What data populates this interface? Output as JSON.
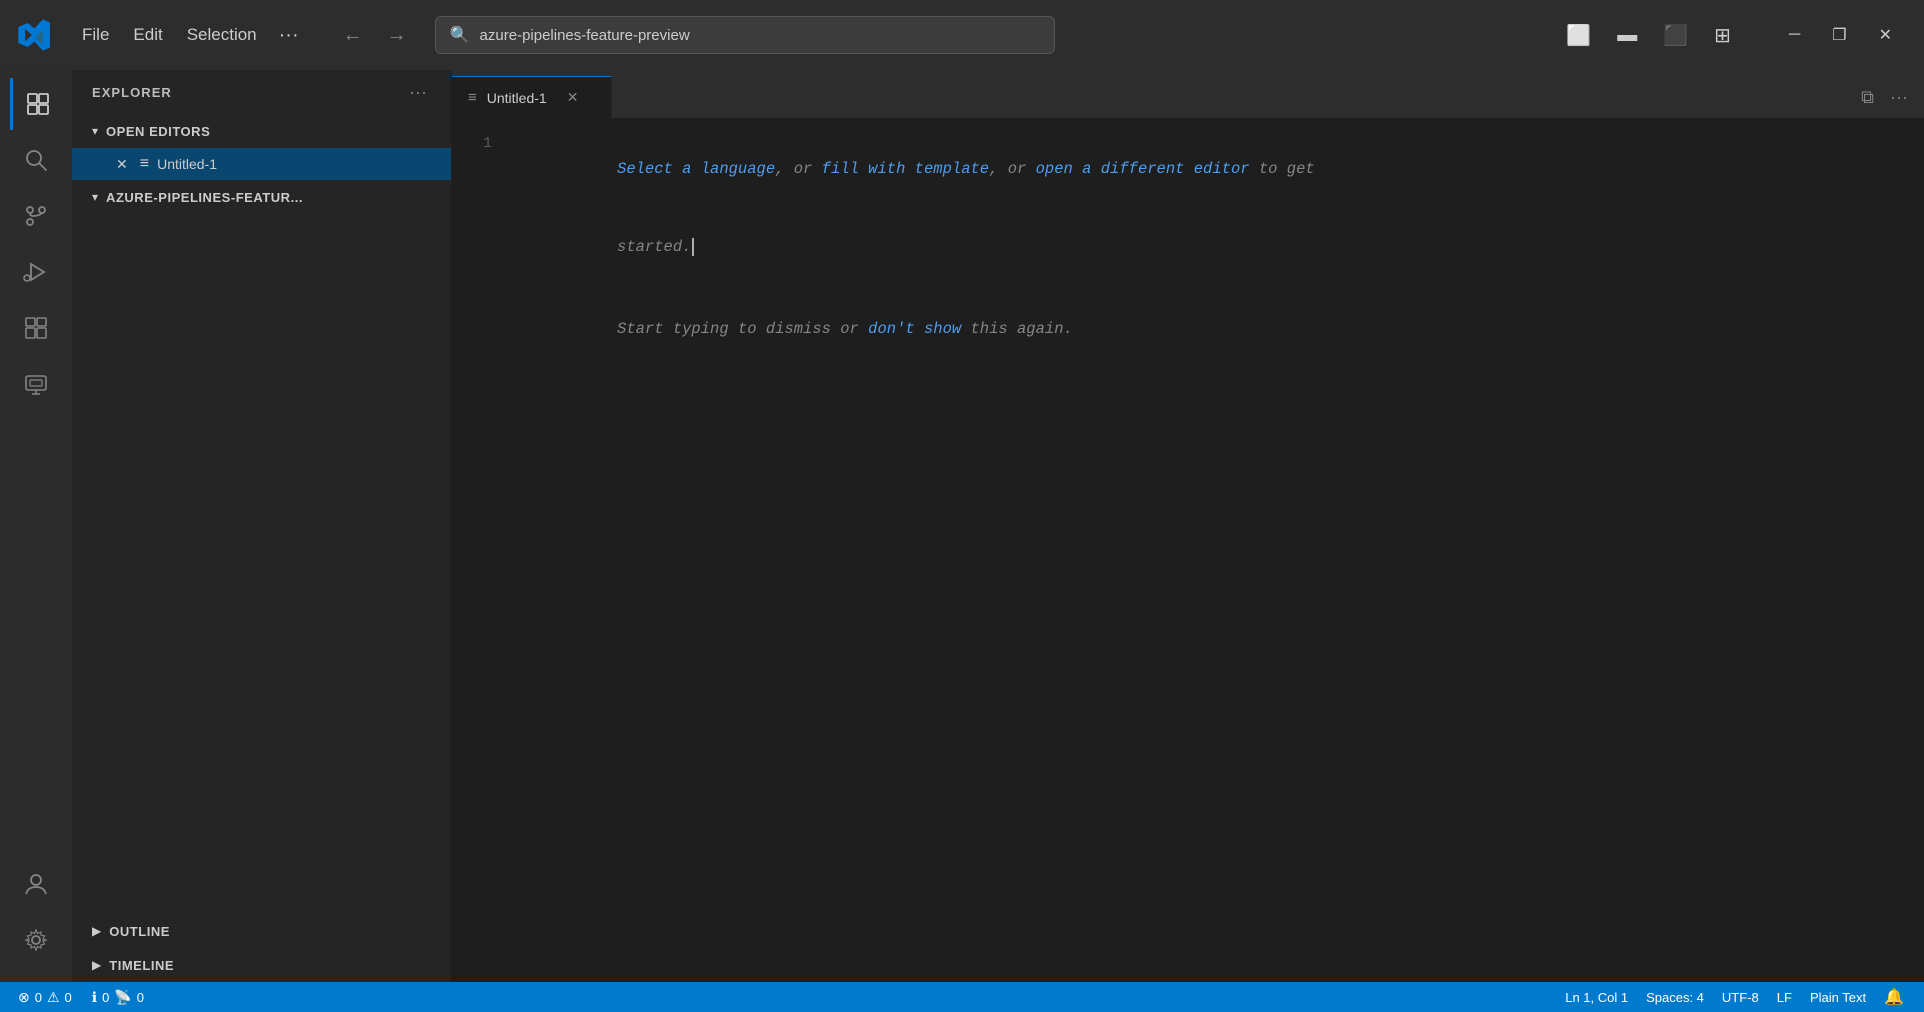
{
  "titleBar": {
    "menus": [
      "File",
      "Edit",
      "Selection",
      "···"
    ],
    "searchPlaceholder": "azure-pipelines-feature-preview",
    "windowControls": [
      "─",
      "❐",
      "✕"
    ]
  },
  "activityBar": {
    "icons": [
      {
        "name": "explorer-icon",
        "symbol": "⧉",
        "active": true
      },
      {
        "name": "search-icon",
        "symbol": "🔍"
      },
      {
        "name": "source-control-icon",
        "symbol": "⑂"
      },
      {
        "name": "run-debug-icon",
        "symbol": "▷"
      },
      {
        "name": "extensions-icon",
        "symbol": "⊞"
      },
      {
        "name": "remote-explorer-icon",
        "symbol": "🖥"
      }
    ],
    "bottomIcons": [
      {
        "name": "accounts-icon",
        "symbol": "👤"
      },
      {
        "name": "settings-icon",
        "symbol": "⚙"
      }
    ]
  },
  "sidebar": {
    "title": "EXPLORER",
    "sections": {
      "openEditors": {
        "label": "OPEN EDITORS",
        "expanded": true,
        "files": [
          {
            "name": "Untitled-1",
            "active": true
          }
        ]
      },
      "folder": {
        "label": "AZURE-PIPELINES-FEATUR...",
        "expanded": true
      },
      "outline": {
        "label": "OUTLINE"
      },
      "timeline": {
        "label": "TIMELINE"
      }
    }
  },
  "editor": {
    "tabs": [
      {
        "name": "Untitled-1",
        "active": true
      }
    ],
    "content": {
      "line1_part1": "Select a language",
      "line1_comma1": ", or ",
      "line1_part2": "fill with template",
      "line1_comma2": ", or ",
      "line1_part3": "open a different editor",
      "line1_end": " to get",
      "line2": "started.",
      "line3_start": "Start typing to dismiss or ",
      "line3_link": "don't show",
      "line3_end": " this again."
    }
  },
  "statusBar": {
    "left": {
      "errors": "0",
      "warnings": "0",
      "info": "0",
      "noProblems": "0"
    },
    "right": {
      "position": "Ln 1, Col 1",
      "spaces": "Spaces: 4",
      "encoding": "UTF-8",
      "lineEnding": "LF",
      "language": "Plain Text",
      "bell": "🔔"
    }
  }
}
